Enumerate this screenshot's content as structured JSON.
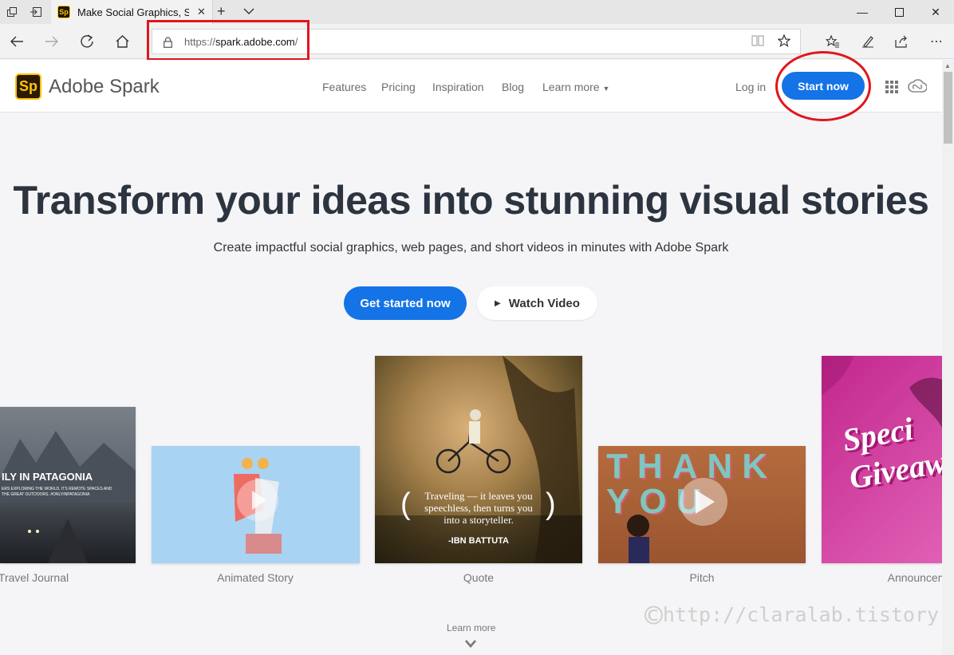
{
  "browser": {
    "tab_title": "Make Social Graphics, S",
    "url_prefix": "https://",
    "url_host": "spark.adobe.com",
    "url_suffix": "/"
  },
  "site": {
    "logo_text": "Sp",
    "brand": "Adobe Spark",
    "nav": [
      {
        "label": "Features"
      },
      {
        "label": "Pricing"
      },
      {
        "label": "Inspiration"
      },
      {
        "label": "Blog"
      },
      {
        "label": "Learn more"
      }
    ],
    "login": "Log in",
    "start_now": "Start now"
  },
  "hero": {
    "title": "Transform your ideas into stunning visual stories",
    "subtitle": "Create impactful social graphics, web pages, and short videos in minutes with Adobe Spark",
    "get_started": "Get started now",
    "watch_video": "Watch Video"
  },
  "cards": [
    {
      "label": "Travel Journal",
      "overlay": "ILY IN PATAGONIA",
      "overlay_small": "ERS EXPLORING THE WORLD, ITS REMOTE SPACES AND THE GREAT OUTDOORS. #ONLYINPATAGONIA"
    },
    {
      "label": "Animated Story"
    },
    {
      "label": "Quote",
      "quote": "Traveling — it leaves you speechless, then turns you into a storyteller.",
      "author": "-IBN BATTUTA"
    },
    {
      "label": "Pitch",
      "overlay": "THANK YOU"
    },
    {
      "label": "Announcem",
      "overlay": "Speci Giveaw"
    }
  ],
  "footer": {
    "learn_more": "Learn more",
    "watermark": "http://claralab.tistory.com"
  },
  "colors": {
    "accent": "#1473e6",
    "highlight": "#e0161e",
    "logo_yellow": "#ffc40c"
  }
}
